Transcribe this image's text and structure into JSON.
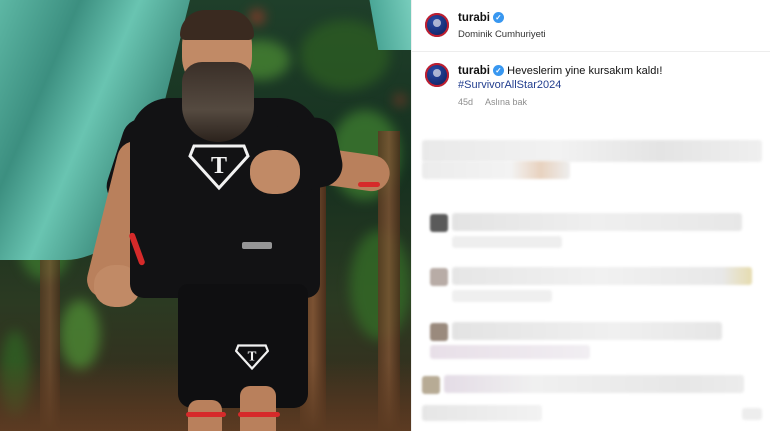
{
  "post": {
    "photo_alt": "Athlete in black Superman-style T shirt",
    "shirt_letter": "T"
  },
  "header": {
    "username": "turabi",
    "verified_mark": "✓",
    "location": "Dominik Cumhuriyeti"
  },
  "caption": {
    "username": "turabi",
    "verified_mark": "✓",
    "text": "Heveslerim yine kursakım kaldı!",
    "hashtag": "#SurvivorAllStar2024",
    "age": "45d",
    "see_translation": "Aslına bak"
  },
  "icons": {
    "avatar": "avatar-icon",
    "verified": "verified-badge-icon"
  },
  "colors": {
    "verified_blue": "#3897f0",
    "hashtag_blue": "#223e8f",
    "meta_gray": "#8e8e8e",
    "avatar_ring": "#c21e2e"
  }
}
